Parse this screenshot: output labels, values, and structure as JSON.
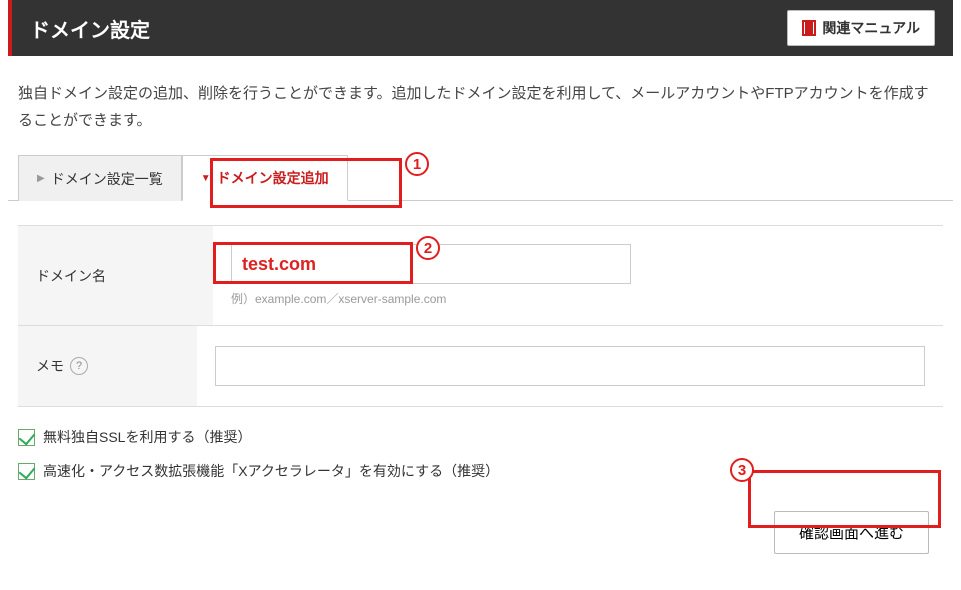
{
  "header": {
    "title": "ドメイン設定",
    "manual_label": "関連マニュアル"
  },
  "description": "独自ドメイン設定の追加、削除を行うことができます。追加したドメイン設定を利用して、メールアカウントやFTPアカウントを作成することができます。",
  "tabs": [
    {
      "label": "ドメイン設定一覧"
    },
    {
      "label": "ドメイン設定追加"
    }
  ],
  "form": {
    "domain": {
      "label": "ドメイン名",
      "value": "test.com",
      "hint": "例）example.com／xserver-sample.com"
    },
    "memo": {
      "label": "メモ",
      "value": ""
    }
  },
  "checks": [
    {
      "label": "無料独自SSLを利用する（推奨）",
      "checked": true
    },
    {
      "label": "高速化・アクセス数拡張機能「Xアクセラレータ」を有効にする（推奨）",
      "checked": true
    }
  ],
  "submit_label": "確認画面へ進む",
  "annotations": {
    "one": "1",
    "two": "2",
    "three": "3"
  }
}
